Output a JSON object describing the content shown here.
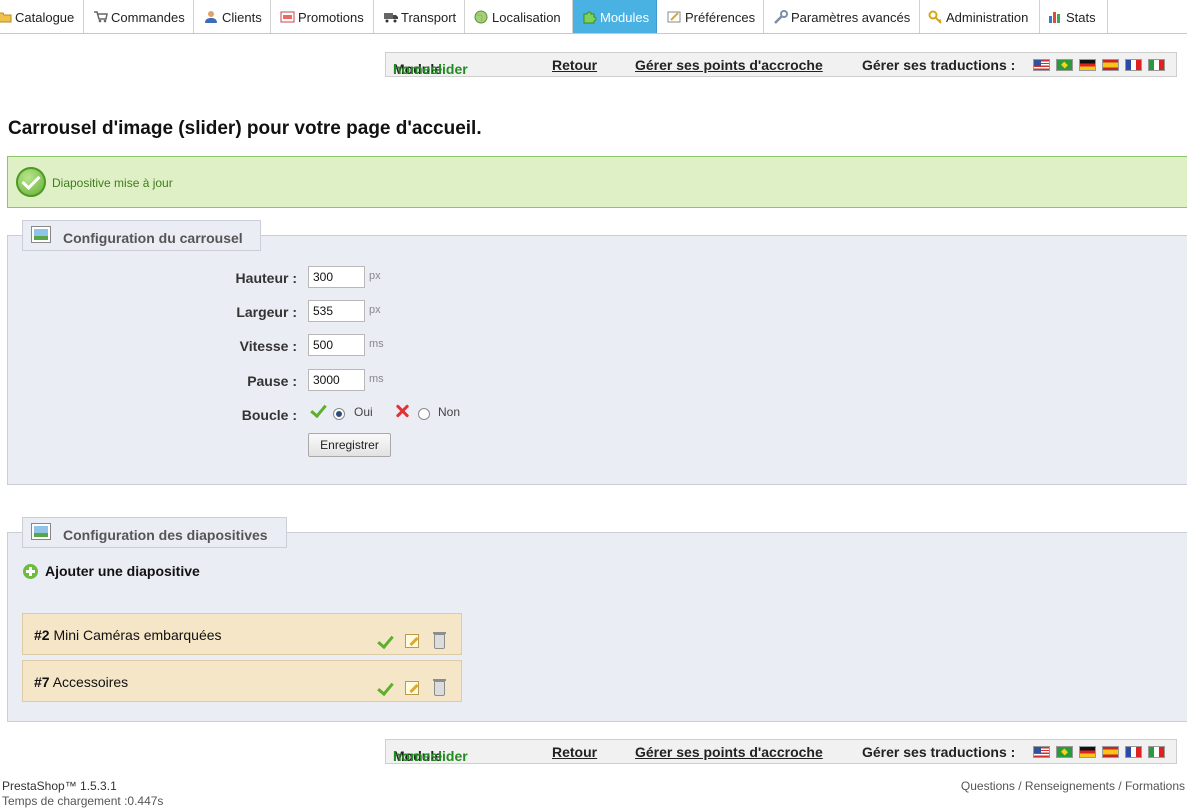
{
  "tabs": [
    {
      "label": "Catalogue",
      "icon": "folder-icon",
      "active": false
    },
    {
      "label": "Commandes",
      "icon": "cart-icon",
      "active": false
    },
    {
      "label": "Clients",
      "icon": "user-icon",
      "active": false
    },
    {
      "label": "Promotions",
      "icon": "promotion-icon",
      "active": false
    },
    {
      "label": "Transport",
      "icon": "truck-icon",
      "active": false
    },
    {
      "label": "Localisation",
      "icon": "globe-icon",
      "active": false
    },
    {
      "label": "Modules",
      "icon": "puzzle-icon",
      "active": true
    },
    {
      "label": "Préférences",
      "icon": "preferences-icon",
      "active": false
    },
    {
      "label": "Paramètres avancés",
      "icon": "wrench-icon",
      "active": false
    },
    {
      "label": "Administration",
      "icon": "key-icon",
      "active": false
    },
    {
      "label": "Stats",
      "icon": "stats-icon",
      "active": false
    }
  ],
  "module_bar": {
    "module_prefix": "Module",
    "module_name": "homeslider",
    "back_label": "Retour",
    "hooks_label": "Gérer ses points d'accroche",
    "translations_label": "Gérer ses traductions :",
    "flags": [
      "en",
      "br",
      "de",
      "es",
      "fr",
      "it"
    ]
  },
  "page_title": "Carrousel d'image (slider) pour votre page d'accueil.",
  "notice": {
    "message": "Diapositive mise à jour"
  },
  "carousel_config": {
    "legend": "Configuration du carrousel",
    "height_label": "Hauteur :",
    "height_value": "300",
    "height_unit": "px",
    "width_label": "Largeur :",
    "width_value": "535",
    "width_unit": "px",
    "speed_label": "Vitesse :",
    "speed_value": "500",
    "speed_unit": "ms",
    "pause_label": "Pause :",
    "pause_value": "3000",
    "pause_unit": "ms",
    "loop_label": "Boucle :",
    "loop_yes": "Oui",
    "loop_no": "Non",
    "loop_selected": "Oui",
    "save_label": "Enregistrer"
  },
  "slides_config": {
    "legend": "Configuration des diapositives",
    "add_label": "Ajouter une diapositive",
    "slides": [
      {
        "number": "#2",
        "title": "Mini Caméras embarquées"
      },
      {
        "number": "#7",
        "title": "Accessoires"
      }
    ]
  },
  "footer": {
    "version": "PrestaShop™ 1.5.3.1",
    "load_time": "Temps de chargement :0.447s",
    "links": "Questions / Renseignements / Formations"
  },
  "colors": {
    "active_tab": "#49b2e3",
    "module_name": "#228b22",
    "notice_bg": "#dff0c6",
    "fieldset_bg": "#ebedf4",
    "slide_bg": "#f5e6c7"
  }
}
